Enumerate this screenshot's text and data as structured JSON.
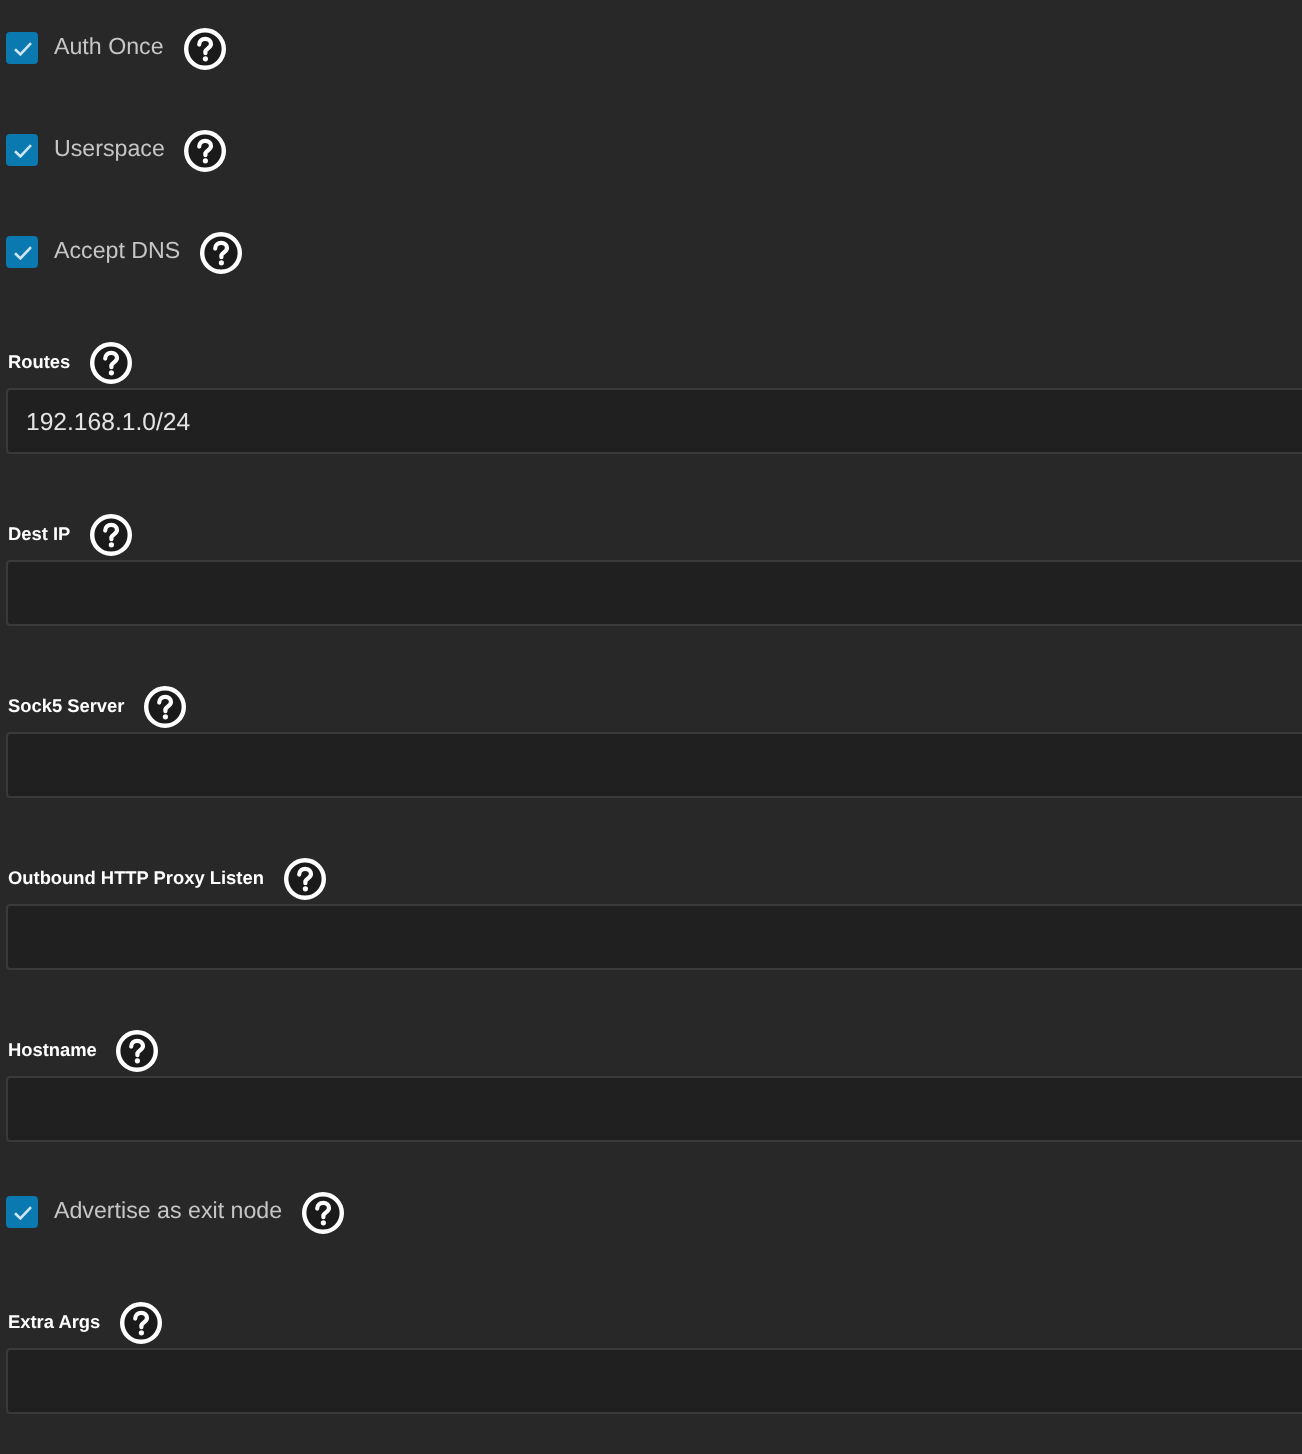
{
  "fields": [
    {
      "kind": "checkbox",
      "label": "Auth Once",
      "checked": true
    },
    {
      "kind": "checkbox",
      "label": "Userspace",
      "checked": true
    },
    {
      "kind": "checkbox",
      "label": "Accept DNS",
      "checked": true
    },
    {
      "kind": "text",
      "label": "Routes",
      "value": "192.168.1.0/24"
    },
    {
      "kind": "text",
      "label": "Dest IP"
    },
    {
      "kind": "text",
      "label": "Sock5 Server"
    },
    {
      "kind": "text",
      "label": "Outbound HTTP Proxy Listen"
    },
    {
      "kind": "text",
      "label": "Hostname"
    },
    {
      "kind": "checkbox",
      "label": "Advertise as exit node",
      "checked": true
    },
    {
      "kind": "text",
      "label": "Extra Args"
    }
  ]
}
